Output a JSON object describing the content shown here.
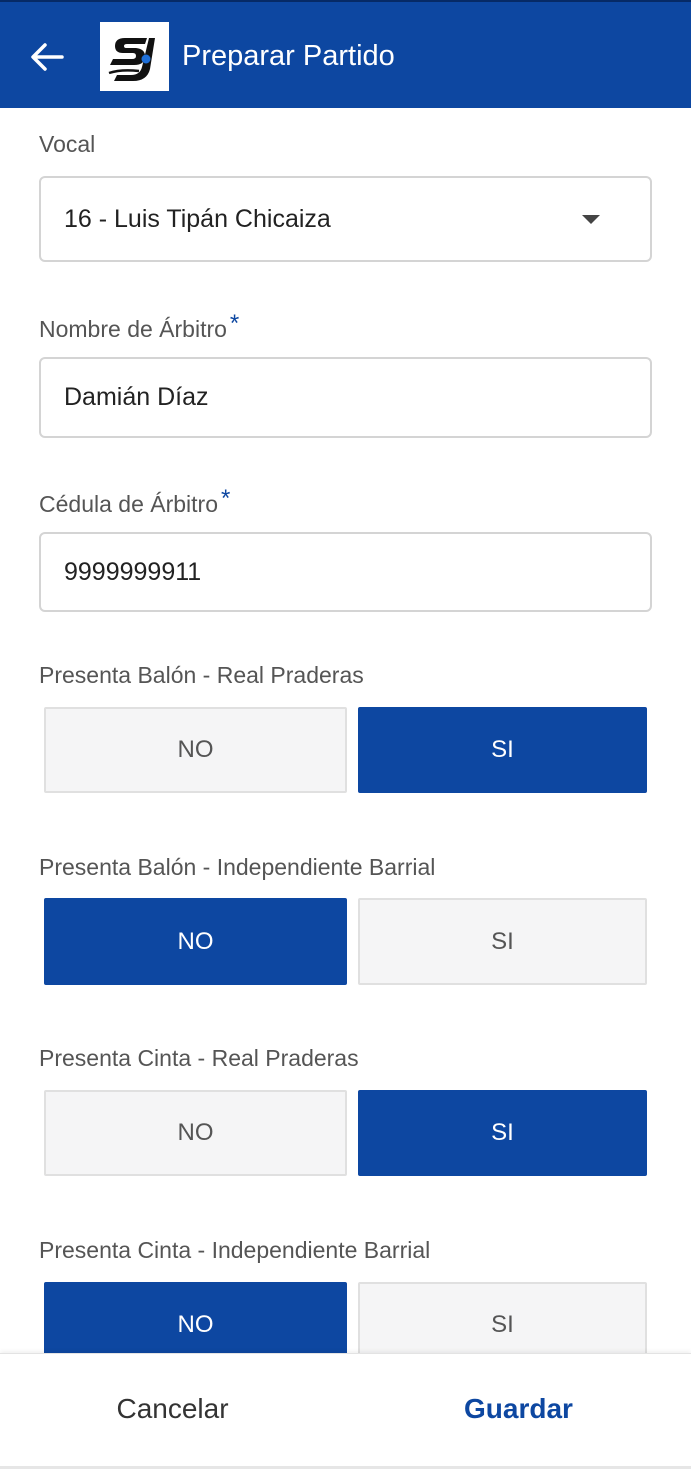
{
  "colors": {
    "primary": "#0d47a1",
    "toggle_off_bg": "#f5f5f6",
    "text": "#333333"
  },
  "header": {
    "title": "Preparar Partido",
    "back_icon": "arrow-left-icon",
    "logo": "sj-logo"
  },
  "form": {
    "vocal": {
      "label": "Vocal",
      "value": "16 - Luis Tipán Chicaiza",
      "icon": "dropdown-caret-icon"
    },
    "referee_name": {
      "label": "Nombre de Árbitro",
      "required_mark": "*",
      "value": "Damián Díaz"
    },
    "referee_id": {
      "label": "Cédula de Árbitro",
      "required_mark": "*",
      "value": "9999999911"
    },
    "toggles": [
      {
        "label": "Presenta Balón - Real Praderas",
        "no": "NO",
        "si": "SI",
        "selected": "SI"
      },
      {
        "label": "Presenta Balón - Independiente Barrial",
        "no": "NO",
        "si": "SI",
        "selected": "NO"
      },
      {
        "label": "Presenta Cinta - Real Praderas",
        "no": "NO",
        "si": "SI",
        "selected": "SI"
      },
      {
        "label": "Presenta Cinta - Independiente Barrial",
        "no": "NO",
        "si": "SI",
        "selected": "NO"
      }
    ]
  },
  "footer": {
    "cancel": "Cancelar",
    "save": "Guardar"
  }
}
